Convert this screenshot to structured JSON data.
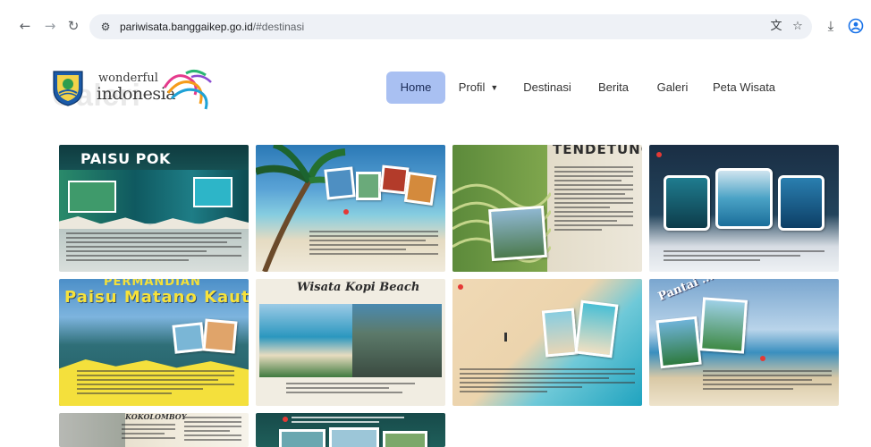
{
  "browser": {
    "url_domain": "pariwisata.banggaikep.go.id",
    "url_path": "/#destinasi",
    "icons": [
      "back-icon",
      "forward-icon",
      "reload-icon",
      "site-settings-icon",
      "translate-icon",
      "bookmark-star-icon",
      "download-icon",
      "profile-icon"
    ]
  },
  "site": {
    "brand_line1": "wonderful",
    "brand_line2": "indonesia",
    "background_heading": "Galeri",
    "nav": [
      {
        "label": "Home",
        "active": true
      },
      {
        "label": "Profil",
        "dropdown": true
      },
      {
        "label": "Destinasi"
      },
      {
        "label": "Berita"
      },
      {
        "label": "Galeri"
      },
      {
        "label": "Peta Wisata"
      }
    ]
  },
  "gallery": {
    "tiles": [
      {
        "title": "PAISU POK"
      },
      {
        "title": ""
      },
      {
        "title": "TENDETUNG"
      },
      {
        "title": ""
      },
      {
        "title_top": "PERMANDIAN",
        "title": "Paisu Matano Kautu"
      },
      {
        "title": "Wisata Kopi Beach"
      },
      {
        "title": ""
      },
      {
        "title": "Pantai ... Loason"
      },
      {
        "title": "KOKOLOMBOY"
      },
      {
        "title": ""
      }
    ]
  },
  "colors": {
    "accent": "#a9c0f2",
    "url_bar": "#eef1f6"
  }
}
